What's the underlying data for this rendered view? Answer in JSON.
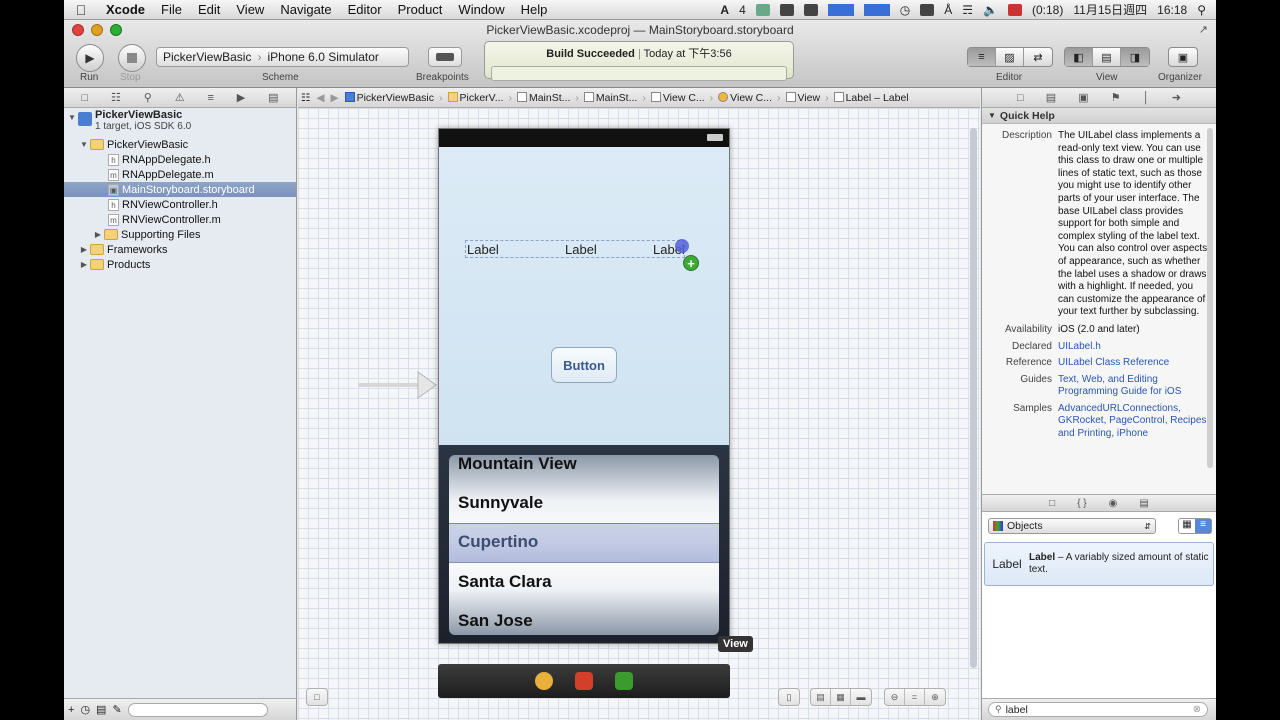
{
  "menubar": {
    "items": [
      "Xcode",
      "File",
      "Edit",
      "View",
      "Navigate",
      "Editor",
      "Product",
      "Window",
      "Help"
    ],
    "status": {
      "badge": "4",
      "battery": "(0:18)",
      "date": "11月15日週四",
      "time": "16:18"
    }
  },
  "window": {
    "title": "PickerViewBasic.xcodeproj — MainStoryboard.storyboard",
    "run_label": "Run",
    "stop_label": "Stop",
    "scheme_label": "Scheme",
    "scheme_project": "PickerViewBasic",
    "scheme_destination": "iPhone 6.0 Simulator",
    "breakpoints_label": "Breakpoints",
    "activity_status": "Build Succeeded",
    "activity_time": "Today at 下午3:56",
    "editor_label": "Editor",
    "view_label": "View",
    "organizer_label": "Organizer"
  },
  "navigator": {
    "project_name": "PickerViewBasic",
    "project_sub": "1 target, iOS SDK 6.0",
    "items": [
      {
        "label": "PickerViewBasic",
        "kind": "folder"
      },
      {
        "label": "RNAppDelegate.h",
        "kind": "h"
      },
      {
        "label": "RNAppDelegate.m",
        "kind": "m"
      },
      {
        "label": "MainStoryboard.storyboard",
        "kind": "storyboard"
      },
      {
        "label": "RNViewController.h",
        "kind": "h"
      },
      {
        "label": "RNViewController.m",
        "kind": "m"
      },
      {
        "label": "Supporting Files",
        "kind": "folder"
      },
      {
        "label": "Frameworks",
        "kind": "folder"
      },
      {
        "label": "Products",
        "kind": "folder"
      }
    ]
  },
  "jumpbar": [
    "PickerViewBasic",
    "PickerV...",
    "MainSt...",
    "MainSt...",
    "View C...",
    "View C...",
    "View",
    "Label – Label"
  ],
  "canvas": {
    "labels": [
      "Label",
      "Label",
      "Label"
    ],
    "button": "Button",
    "picker_rows": [
      "Mountain View",
      "Sunnyvale",
      "Cupertino",
      "Santa Clara",
      "San Jose"
    ],
    "tooltip": "View"
  },
  "quick_help": {
    "header": "Quick Help",
    "description_key": "Description",
    "description": "The UILabel class implements a read-only text view. You can use this class to draw one or multiple lines of static text, such as those you might use to identify other parts of your user interface. The base UILabel class provides support for both simple and complex styling of the label text. You can also control over aspects of appearance, such as whether the label uses a shadow or draws with a highlight. If needed, you can customize the appearance of your text further by subclassing.",
    "availability_key": "Availability",
    "availability": "iOS (2.0 and later)",
    "declared_key": "Declared",
    "declared": "UILabel.h",
    "reference_key": "Reference",
    "reference": "UILabel Class Reference",
    "guides_key": "Guides",
    "guides": "Text, Web, and Editing Programming Guide for iOS",
    "samples_key": "Samples",
    "samples": "AdvancedURLConnections, GKRocket, PageControl, Recipes and Printing, iPhone"
  },
  "library": {
    "selector": "Objects",
    "item_title": "Label",
    "item_name": "Label",
    "item_desc": "– A variably sized amount of static text.",
    "search": "label"
  },
  "colors": {
    "selection": "#7b93bd",
    "link": "#2a56b3",
    "canvas_grid": "#d8dfe9"
  }
}
